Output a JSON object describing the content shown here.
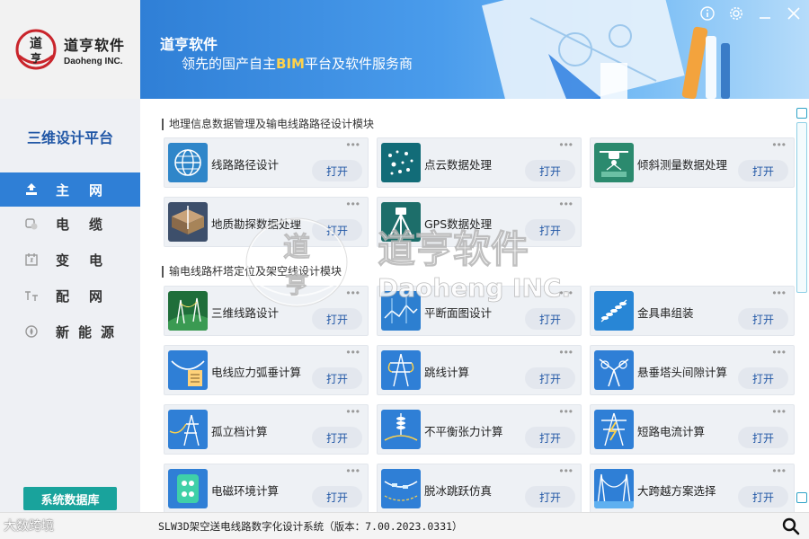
{
  "app": {
    "logo_cn": "道亨软件",
    "logo_en": "Daoheng INC.",
    "banner_title": "道亨软件",
    "banner_sub_pre": "领先的国产自主",
    "banner_sub_bim": "BIM",
    "banner_sub_post": "平台及软件服务商"
  },
  "sidebar": {
    "platform_title": "三维设计平台",
    "items": [
      {
        "label": "主网",
        "icon": "grid-icon",
        "active": true
      },
      {
        "label": "电缆",
        "icon": "cable-icon",
        "active": false
      },
      {
        "label": "变电",
        "icon": "substation-icon",
        "active": false
      },
      {
        "label": "配网",
        "icon": "distribution-icon",
        "active": false
      },
      {
        "label": "新能源",
        "icon": "new-energy-icon",
        "active": false
      }
    ],
    "system_db_label": "系统数据库"
  },
  "sections": [
    {
      "title": "地理信息数据管理及输电线路路径设计模块",
      "cards": [
        {
          "name": "线路路径设计",
          "icon": "globe-icon",
          "open": "打开",
          "more": "•••"
        },
        {
          "name": "点云数据处理",
          "icon": "point-cloud-icon",
          "open": "打开",
          "more": "•••"
        },
        {
          "name": "倾斜测量数据处理",
          "icon": "drone-icon",
          "open": "打开",
          "more": "•••"
        },
        {
          "name": "地质勘探数据处理",
          "icon": "geology-icon",
          "open": "打开",
          "more": "•••"
        },
        {
          "name": "GPS数据处理",
          "icon": "gps-tripod-icon",
          "open": "打开",
          "more": "•••"
        }
      ]
    },
    {
      "title": "输电线路杆塔定位及架空线设计模块",
      "cards": [
        {
          "name": "三维线路设计",
          "icon": "3d-line-icon",
          "open": "打开",
          "more": "•••"
        },
        {
          "name": "平断面图设计",
          "icon": "profile-icon",
          "open": "打开",
          "more": "•••"
        },
        {
          "name": "金具串组装",
          "icon": "insulator-icon",
          "open": "打开",
          "more": "•••"
        },
        {
          "name": "电线应力弧垂计算",
          "icon": "sag-icon",
          "open": "打开",
          "more": "•••"
        },
        {
          "name": "跳线计算",
          "icon": "jumper-icon",
          "open": "打开",
          "more": "•••"
        },
        {
          "name": "悬垂塔头间隙计算",
          "icon": "tower-head-icon",
          "open": "打开",
          "more": "•••"
        },
        {
          "name": "孤立档计算",
          "icon": "isolated-span-icon",
          "open": "打开",
          "more": "•••"
        },
        {
          "name": "不平衡张力计算",
          "icon": "tension-icon",
          "open": "打开",
          "more": "•••"
        },
        {
          "name": "短路电流计算",
          "icon": "short-circuit-icon",
          "open": "打开",
          "more": "•••"
        },
        {
          "name": "电磁环境计算",
          "icon": "emf-icon",
          "open": "打开",
          "more": "•••"
        },
        {
          "name": "脱冰跳跃仿真",
          "icon": "ice-shedding-icon",
          "open": "打开",
          "more": "•••"
        },
        {
          "name": "大跨越方案选择",
          "icon": "long-span-icon",
          "open": "打开",
          "more": "•••"
        }
      ]
    }
  ],
  "watermark": {
    "cn": "道亨软件",
    "en": "Daoheng INC."
  },
  "footer": {
    "status": "SLW3D架空送电线路数字化设计系统（版本：7.00.2023.0331）",
    "corner_mark": "大数跨境"
  },
  "colors": {
    "accent": "#2f7fd6",
    "sidebar_bg": "#eef0f4",
    "card_bg": "#eef1f5",
    "db_button": "#19a39c",
    "highlight": "#ffd24a"
  }
}
